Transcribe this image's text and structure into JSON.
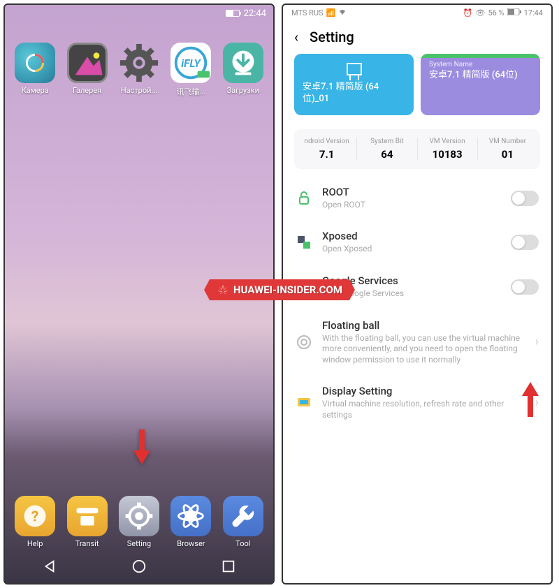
{
  "left": {
    "status": {
      "time": "22:44"
    },
    "apps": [
      {
        "label": "Камера"
      },
      {
        "label": "Галерея"
      },
      {
        "label": "Настрой..."
      },
      {
        "label": "讯飞输..."
      },
      {
        "label": "Загрузки"
      }
    ],
    "dock": [
      {
        "label": "Help"
      },
      {
        "label": "Transit"
      },
      {
        "label": "Setting"
      },
      {
        "label": "Browser"
      },
      {
        "label": "Tool"
      }
    ]
  },
  "right": {
    "status": {
      "carrier": "MTS RUS",
      "battery": "56 %",
      "time": "17:44"
    },
    "header": {
      "title": "Setting"
    },
    "cards": [
      {
        "title": "安卓7.1 精简版 (64位)_01"
      },
      {
        "sub": "System Name",
        "title": "安卓7.1 精简版 (64位)"
      }
    ],
    "info": [
      {
        "label": "ndroid Version",
        "value": "7.1"
      },
      {
        "label": "System Bit",
        "value": "64"
      },
      {
        "label": "VM Version",
        "value": "10183"
      },
      {
        "label": "VM Number",
        "value": "01"
      }
    ],
    "settings": [
      {
        "title": "ROOT",
        "sub": "Open ROOT"
      },
      {
        "title": "Xposed",
        "sub": "Open Xposed"
      },
      {
        "title": "Google Services",
        "sub": "Open Google Services"
      },
      {
        "title": "Floating ball",
        "sub": "With the floating ball, you can use the virtual machine more conveniently, and you need to open the floating window permission to use it normally"
      },
      {
        "title": "Display Setting",
        "sub": "Virtual machine resolution, refresh rate and other settings"
      }
    ]
  },
  "watermark": "HUAWEI-INSIDER.COM"
}
